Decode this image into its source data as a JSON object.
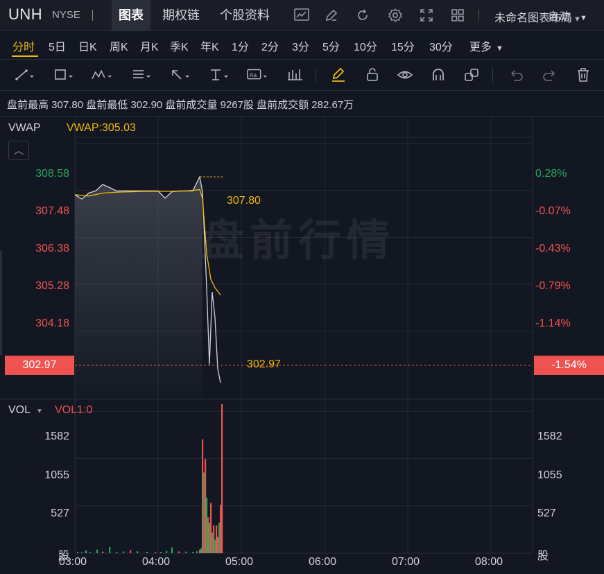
{
  "header": {
    "ticker": "UNH",
    "exchange": "NYSE",
    "tabs": [
      "图表",
      "期权链",
      "个股资料"
    ],
    "active_tab": "图表",
    "layout_name": "未命名图表布局",
    "icons": [
      "chart-line-icon",
      "pencil-icon",
      "refresh-icon",
      "settings-icon",
      "fullscreen-icon",
      "grid-layout-icon"
    ]
  },
  "periods": {
    "items": [
      "分时",
      "5日",
      "日K",
      "周K",
      "月K",
      "季K",
      "年K",
      "1分",
      "2分",
      "3分",
      "5分",
      "10分",
      "15分",
      "30分",
      "更多"
    ],
    "active": "分时",
    "mode": "自动"
  },
  "drawing_tools": [
    "trend-line-icon",
    "rectangle-icon",
    "pattern-icon",
    "fib-icon",
    "arrow-icon",
    "measure-icon",
    "text-note-icon",
    "bar-pattern-icon",
    "highlighter-icon",
    "lock-icon",
    "eye-icon",
    "magnet-icon",
    "clone-icon",
    "undo-icon",
    "redo-icon",
    "trash-icon"
  ],
  "stats": {
    "text": "盘前最高 307.80 盘前最低 302.90 盘前成交量 9267股 盘前成交额 282.67万"
  },
  "price_pane": {
    "indicator": "VWAP",
    "indicator_value": "VWAP:305.03",
    "watermark": "盘前行情",
    "left_ticks": [
      "308.58",
      "307.48",
      "306.38",
      "305.28",
      "304.18"
    ],
    "right_ticks": [
      "0.28%",
      "-0.07%",
      "-0.43%",
      "-0.79%",
      "-1.14%"
    ],
    "current_price": "302.97",
    "current_pct": "-1.54%",
    "high_marker": "307.80",
    "last_marker": "302.97"
  },
  "volume_pane": {
    "indicator": "VOL",
    "indicator_value": "VOL1:0",
    "ticks": [
      "1582",
      "1055",
      "527"
    ],
    "unit": "股"
  },
  "x_axis": {
    "labels": [
      "03:00",
      "04:00",
      "05:00",
      "06:00",
      "07:00",
      "08:00"
    ]
  },
  "chart_data": [
    {
      "type": "line",
      "title": "",
      "series": [
        {
          "name": "price",
          "color": "#d1d4dc",
          "x": [
            "03:00",
            "03:05",
            "03:10",
            "03:15",
            "03:20",
            "03:25",
            "03:30",
            "03:40",
            "03:50",
            "04:00",
            "04:05",
            "04:10",
            "04:15",
            "04:20",
            "04:25",
            "04:30",
            "04:32",
            "04:35",
            "04:37",
            "04:39",
            "04:41",
            "04:43",
            "04:45"
          ],
          "values": [
            307.38,
            307.28,
            307.42,
            307.47,
            307.62,
            307.55,
            307.47,
            307.47,
            307.47,
            307.47,
            307.3,
            307.45,
            307.47,
            307.47,
            307.47,
            307.8,
            307.45,
            305.2,
            303.4,
            305.1,
            304.5,
            303.3,
            302.97
          ]
        },
        {
          "name": "VWAP",
          "color": "#f0b90b",
          "x": [
            "03:00",
            "03:10",
            "03:20",
            "03:30",
            "03:40",
            "03:50",
            "04:00",
            "04:10",
            "04:20",
            "04:30",
            "04:32",
            "04:35",
            "04:38",
            "04:41",
            "04:45"
          ],
          "values": [
            307.38,
            307.35,
            307.42,
            307.44,
            307.45,
            307.46,
            307.46,
            307.46,
            307.47,
            307.5,
            307.3,
            306.0,
            305.4,
            305.2,
            305.03
          ]
        }
      ],
      "ylim": [
        302.6,
        309.2
      ],
      "grid": true
    },
    {
      "type": "bar",
      "title": "",
      "x": [
        "03:02",
        "03:05",
        "03:08",
        "03:11",
        "03:16",
        "03:20",
        "03:25",
        "03:30",
        "03:35",
        "03:40",
        "03:45",
        "03:52",
        "03:58",
        "04:02",
        "04:06",
        "04:10",
        "04:15",
        "04:20",
        "04:25",
        "04:28",
        "04:30",
        "04:31",
        "04:32",
        "04:33",
        "04:34",
        "04:35",
        "04:36",
        "04:37",
        "04:38",
        "04:39",
        "04:40",
        "04:41",
        "04:42",
        "04:43",
        "04:44",
        "04:45",
        "04:46"
      ],
      "values": [
        15,
        10,
        30,
        12,
        40,
        18,
        70,
        15,
        20,
        35,
        22,
        15,
        12,
        15,
        25,
        65,
        20,
        18,
        15,
        22,
        40,
        55,
        1270,
        900,
        1050,
        620,
        400,
        340,
        560,
        230,
        310,
        150,
        310,
        180,
        340,
        540,
        1660
      ],
      "up": [
        true,
        true,
        true,
        true,
        true,
        false,
        true,
        true,
        true,
        false,
        true,
        true,
        false,
        true,
        true,
        true,
        false,
        true,
        true,
        true,
        false,
        true,
        false,
        true,
        false,
        true,
        false,
        true,
        false,
        true,
        false,
        true,
        false,
        false,
        true,
        false,
        false
      ],
      "ylim": [
        0,
        1700
      ]
    }
  ]
}
